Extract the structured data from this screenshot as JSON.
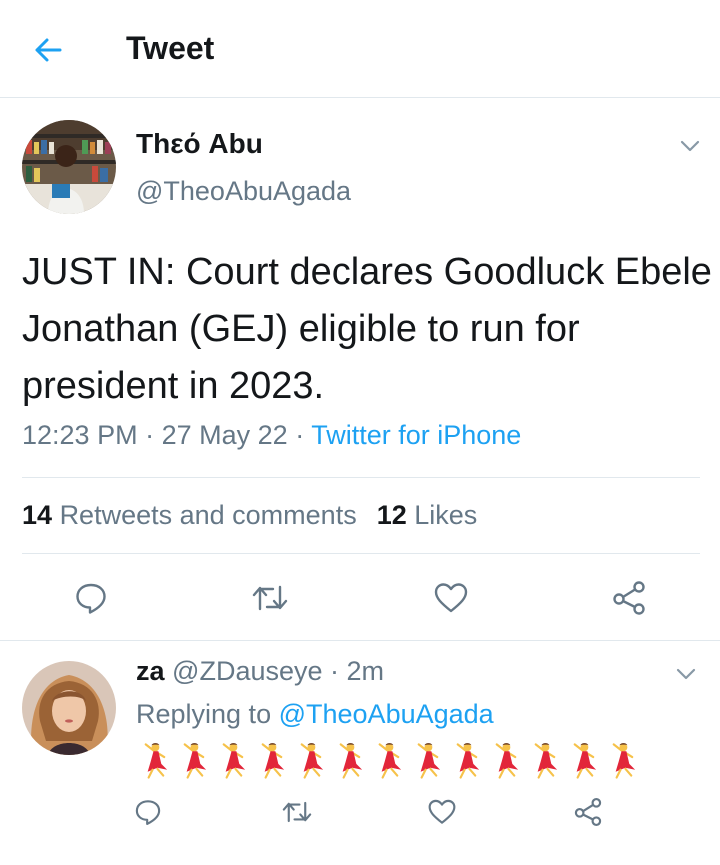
{
  "header": {
    "title": "Tweet"
  },
  "tweet": {
    "author_name": "Thεό Abu",
    "author_handle": "@TheoAbuAgada",
    "text": "JUST IN: Court declares Goodluck Ebele Jonathan (GEJ) eligible to run for president in 2023.",
    "time": "12:23 PM",
    "date": "27 May 22",
    "source": "Twitter for iPhone",
    "retweets_count": "14",
    "retweets_label": "Retweets and comments",
    "likes_count": "12",
    "likes_label": "Likes"
  },
  "reply": {
    "name": "za",
    "handle": "@ZDauseye",
    "time": "2m",
    "replying_prefix": "Replying to",
    "replying_to": "@TheoAbuAgada",
    "emoji": "💃💃💃💃💃💃💃💃💃💃💃💃💃",
    "emoji_count": 13
  },
  "colors": {
    "accent": "#1da1f2",
    "secondary_text": "#657786",
    "divider": "#e1e8ed",
    "icon_gray": "#657786"
  },
  "icons": {
    "back": "arrow-left-icon",
    "chevron": "chevron-down-icon",
    "reply": "comment-icon",
    "retweet": "retweet-icon",
    "like": "heart-icon",
    "share": "share-icon"
  }
}
